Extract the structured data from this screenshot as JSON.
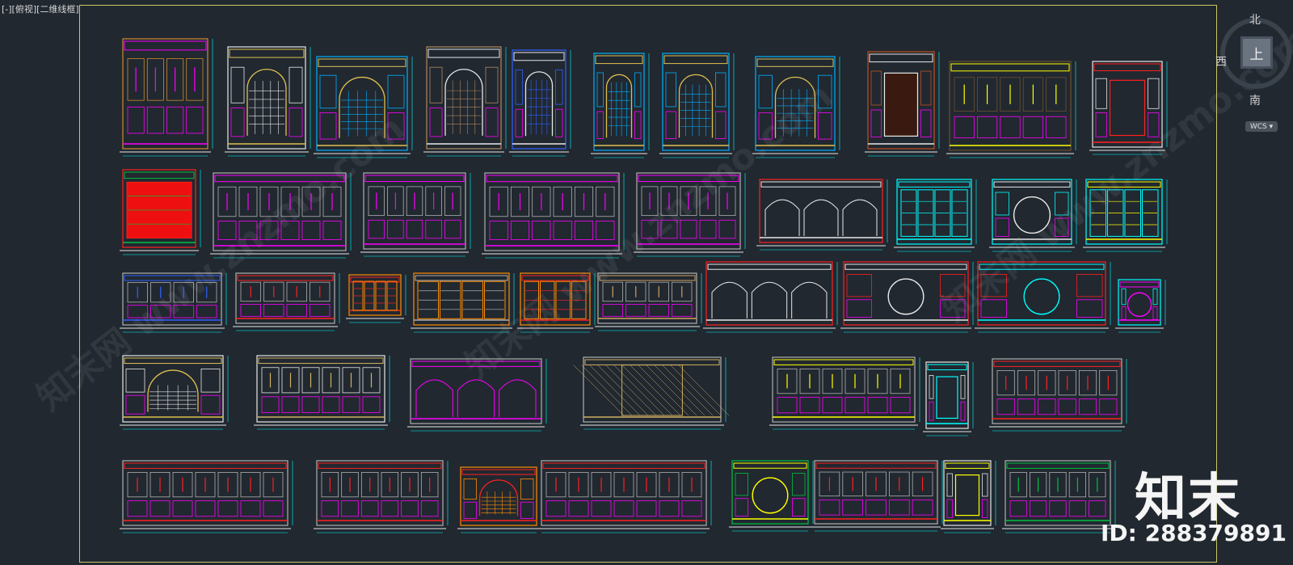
{
  "viewport": {
    "label": "[-][俯视][二维线框]"
  },
  "viewcube": {
    "north": "北",
    "south": "南",
    "west": "西",
    "face": "上"
  },
  "wcs": {
    "label": "WCS ▾"
  },
  "watermark": {
    "logo": "知末",
    "id": "ID: 288379891"
  },
  "colors": {
    "background": "#212830",
    "sheet_border": "#c8c864",
    "line_white": "#e8e8e8",
    "magenta": "#ff00ff",
    "cyan": "#00ffff",
    "yellow": "#ffff00",
    "red": "#ff2020",
    "orange": "#ff8c00",
    "green": "#00c040",
    "brown": "#6b5030",
    "blue": "#3060ff"
  },
  "drawing_items": [
    {
      "style": "ornate-panel",
      "color": "#d08a30",
      "accent": "#ff00ff"
    },
    {
      "style": "classic-door",
      "color": "#e8e8e8",
      "accent": "#e0c050"
    },
    {
      "style": "classic-door",
      "color": "#00b0ff",
      "accent": "#e0c050"
    },
    {
      "style": "arch-lattice",
      "color": "#b08860",
      "accent": "#e8e8e8"
    },
    {
      "style": "arch-lattice",
      "color": "#3060ff",
      "accent": "#e8e8e8"
    },
    {
      "style": "arch-lattice",
      "color": "#00b0ff",
      "accent": "#e0c050"
    },
    {
      "style": "arch-lattice",
      "color": "#00b0ff",
      "accent": "#e0c050"
    },
    {
      "style": "arch-lattice",
      "color": "#00b0ff",
      "accent": "#e0c050"
    },
    {
      "style": "fireplace",
      "color": "#c05020",
      "accent": "#e8e8e8"
    },
    {
      "style": "wall-panel",
      "color": "#6b5030",
      "accent": "#ffff00"
    },
    {
      "style": "doorway",
      "color": "#e8e8e8",
      "accent": "#ff2020"
    },
    {
      "style": "red-panel",
      "color": "#ff2020",
      "accent": "#00c040"
    },
    {
      "style": "wall-panel",
      "color": "#b0b0b0",
      "accent": "#ff00ff"
    },
    {
      "style": "wall-panel",
      "color": "#b0b0b0",
      "accent": "#ff00ff"
    },
    {
      "style": "wall-panel",
      "color": "#b0b0b0",
      "accent": "#ff00ff"
    },
    {
      "style": "wall-panel",
      "color": "#b0b0b0",
      "accent": "#ff00ff"
    },
    {
      "style": "arch-row",
      "color": "#ff2020",
      "accent": "#e8e8e8"
    },
    {
      "style": "screen",
      "color": "#00ffff",
      "accent": "#00ffff"
    },
    {
      "style": "moon-gate",
      "color": "#00ffff",
      "accent": "#e8e8e8"
    },
    {
      "style": "screen",
      "color": "#00ffff",
      "accent": "#ffff00"
    },
    {
      "style": "wall-panel",
      "color": "#b0b0b0",
      "accent": "#3060ff"
    },
    {
      "style": "wall-panel",
      "color": "#b0b0b0",
      "accent": "#ff2020"
    },
    {
      "style": "cabinet",
      "color": "#ff8c00",
      "accent": "#ff2020"
    },
    {
      "style": "cabinet",
      "color": "#ff8c00",
      "accent": "#b0b0b0"
    },
    {
      "style": "cabinet",
      "color": "#ff8c00",
      "accent": "#ff2020"
    },
    {
      "style": "wall-panel",
      "color": "#b0b0b0",
      "accent": "#d0a060"
    },
    {
      "style": "arch-row",
      "color": "#ff2020",
      "accent": "#e8e8e8"
    },
    {
      "style": "moon-gate",
      "color": "#ff2020",
      "accent": "#e8e8e8"
    },
    {
      "style": "moon-gate",
      "color": "#ff2020",
      "accent": "#00ffff"
    },
    {
      "style": "moon-gate",
      "color": "#00ffff",
      "accent": "#ff00ff"
    },
    {
      "style": "arch-lattice",
      "color": "#e8e8e8",
      "accent": "#e0c050"
    },
    {
      "style": "wall-panel",
      "color": "#e8e8e8",
      "accent": "#d0b060"
    },
    {
      "style": "arch-row",
      "color": "#b0b0b0",
      "accent": "#ff00ff"
    },
    {
      "style": "lattice-wall",
      "color": "#b0b0b0",
      "accent": "#d0b060"
    },
    {
      "style": "wall-panel",
      "color": "#b0b0b0",
      "accent": "#ffff00"
    },
    {
      "style": "doorway",
      "color": "#e8e8e8",
      "accent": "#00ffff"
    },
    {
      "style": "wall-panel",
      "color": "#b0b0b0",
      "accent": "#ff2020"
    },
    {
      "style": "wall-panel",
      "color": "#b0b0b0",
      "accent": "#ff2020"
    },
    {
      "style": "wall-panel",
      "color": "#b0b0b0",
      "accent": "#ff2020"
    },
    {
      "style": "arch-lattice",
      "color": "#ff8c00",
      "accent": "#ff2020"
    },
    {
      "style": "wall-panel",
      "color": "#b0b0b0",
      "accent": "#ff2020"
    },
    {
      "style": "moon-gate",
      "color": "#00c040",
      "accent": "#ffff00"
    },
    {
      "style": "wall-panel",
      "color": "#b0b0b0",
      "accent": "#ff2020"
    },
    {
      "style": "doorway",
      "color": "#e8e8e8",
      "accent": "#ffff00"
    },
    {
      "style": "wall-panel",
      "color": "#b0b0b0",
      "accent": "#00c040"
    }
  ]
}
